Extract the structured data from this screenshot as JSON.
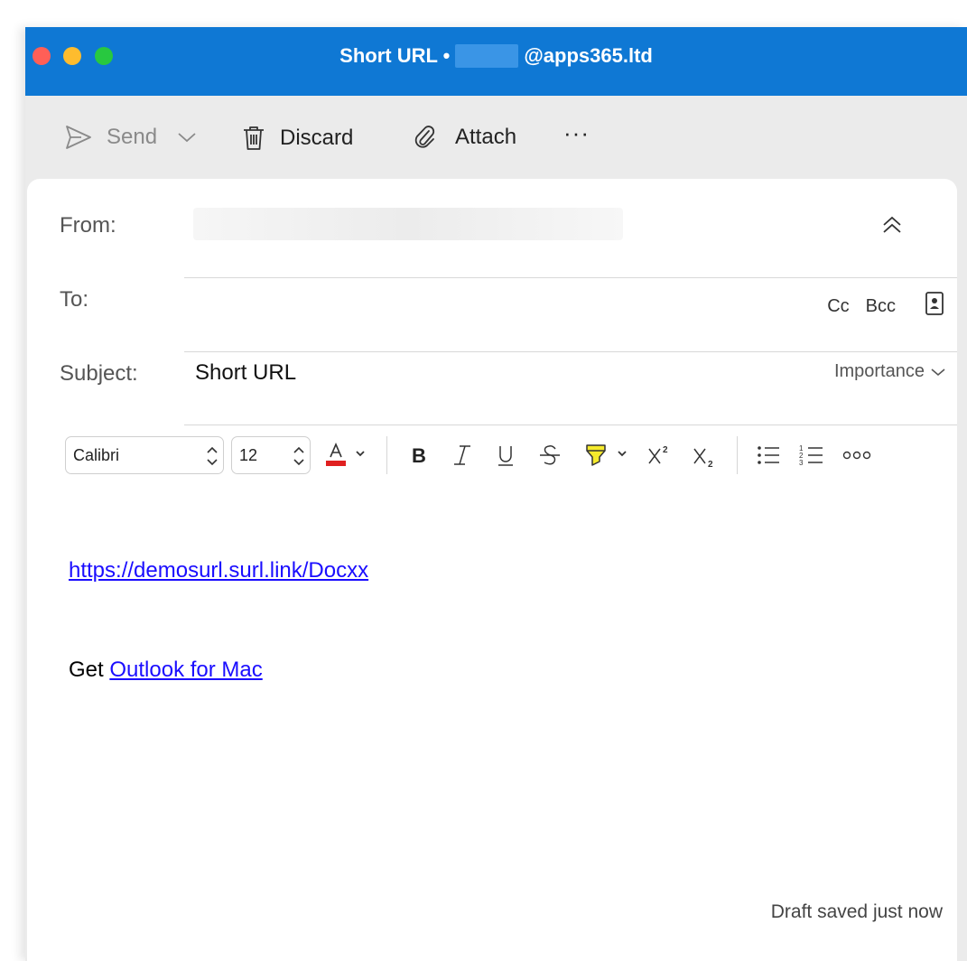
{
  "window": {
    "title": "Short URL •",
    "title_email_suffix": "@apps365.ltd",
    "accent_color": "#0f78d4"
  },
  "toolbar": {
    "send_label": "Send",
    "discard_label": "Discard",
    "attach_label": "Attach",
    "more_label": "···"
  },
  "fields": {
    "from_label": "From:",
    "to_label": "To:",
    "cc_label": "Cc",
    "bcc_label": "Bcc",
    "subject_label": "Subject:",
    "subject_value": "Short URL",
    "importance_label": "Importance"
  },
  "format": {
    "font_name": "Calibri",
    "font_size": "12",
    "font_color": "#e02020",
    "highlight_color": "#f5ea2c",
    "superscript_label": "X²",
    "subscript_label": "X₂"
  },
  "body": {
    "link_text": "https://demosurl.surl.link/Docxx",
    "signature_prefix": "Get",
    "signature_link": "Outlook for Mac"
  },
  "status": {
    "draft_text": "Draft saved just now"
  }
}
